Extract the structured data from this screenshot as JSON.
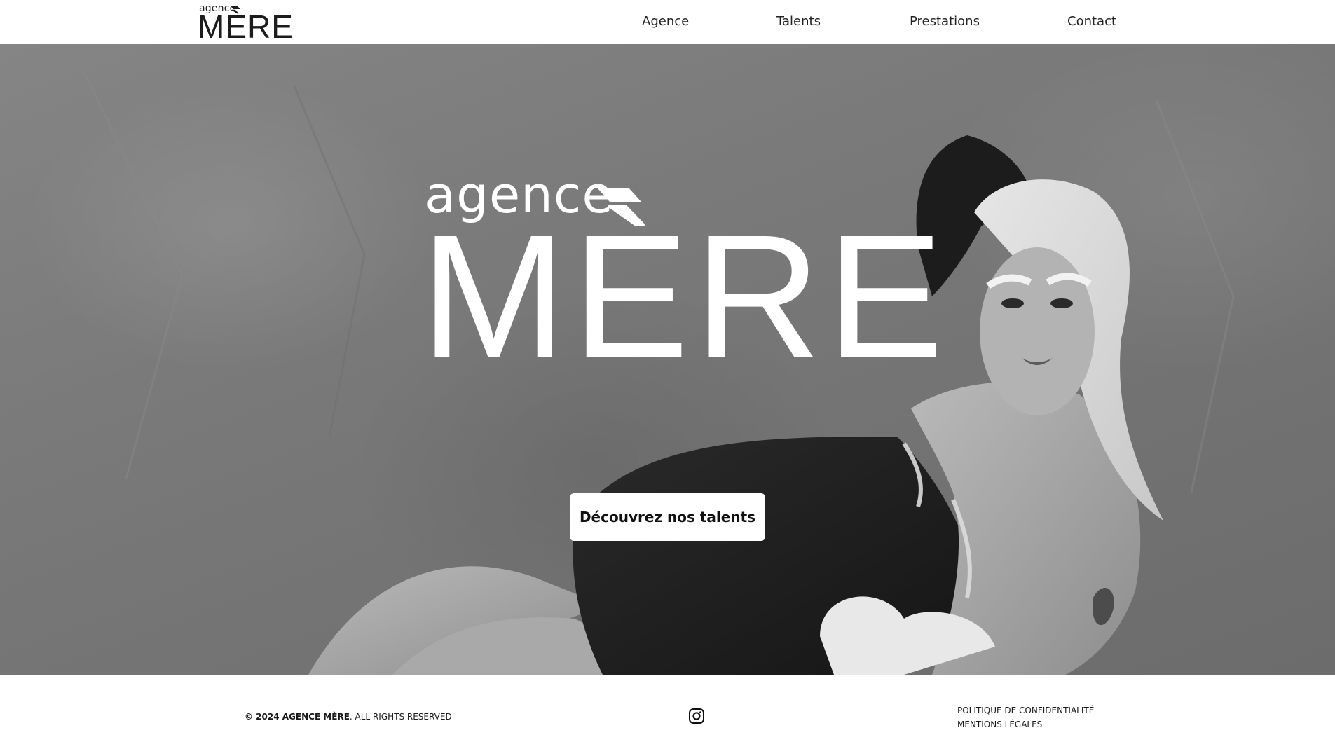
{
  "header": {
    "logo": {
      "small": "agence",
      "big": "MÈRE"
    },
    "nav": [
      {
        "label": "Agence"
      },
      {
        "label": "Talents"
      },
      {
        "label": "Prestations"
      },
      {
        "label": "Contact"
      }
    ]
  },
  "hero": {
    "logo": {
      "small": "agence",
      "big": "MÈRE"
    },
    "cta_label": "Découvrez nos talents"
  },
  "footer": {
    "copyright_bold": "© 2024 AGENCE MÈRE",
    "copyright_rest": ". ALL RIGHTS RESERVED",
    "social_icon": "instagram-icon",
    "links": [
      {
        "label": "POLITIQUE DE CONFIDENTIALITÉ"
      },
      {
        "label": "MENTIONS LÉGALES"
      }
    ]
  },
  "colors": {
    "background": "#ffffff",
    "hero_gray": "#7a7a7a",
    "text": "#1a1a1a",
    "cta_background": "#ffffff"
  }
}
